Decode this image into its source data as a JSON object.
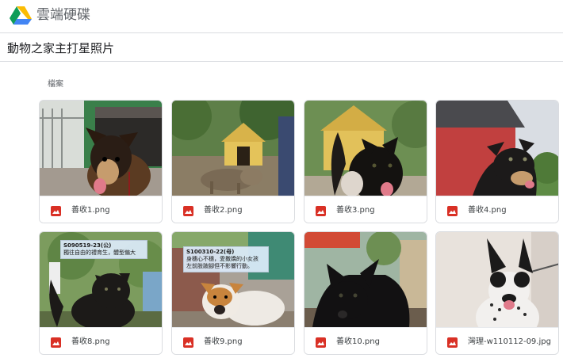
{
  "app": {
    "title": "雲端硬碟",
    "logo_icon": "google-drive-logo"
  },
  "folder": {
    "title": "動物之家主打星照片"
  },
  "section": {
    "label": "檔案"
  },
  "colors": {
    "image_icon": "#d93025",
    "border": "#dadce0"
  },
  "files": [
    {
      "name": "善收1.png",
      "icon": "image-file-icon"
    },
    {
      "name": "善收2.png",
      "icon": "image-file-icon"
    },
    {
      "name": "善收3.png",
      "icon": "image-file-icon"
    },
    {
      "name": "善收4.png",
      "icon": "image-file-icon"
    },
    {
      "name": "善收8.png",
      "icon": "image-file-icon",
      "sign_code": "S090519-23(公)",
      "sign_text": "獨往自由的禮育生，體型偏大"
    },
    {
      "name": "善收9.png",
      "icon": "image-file-icon",
      "sign_code": "S100310-22(母)",
      "sign_text": "身穗心不穗，愛撒嬌的小女孩 左前肢跛腳但不影響行動。"
    },
    {
      "name": "善收10.png",
      "icon": "image-file-icon"
    },
    {
      "name": "灣理-w110112-09.jpg",
      "icon": "image-file-icon"
    }
  ]
}
